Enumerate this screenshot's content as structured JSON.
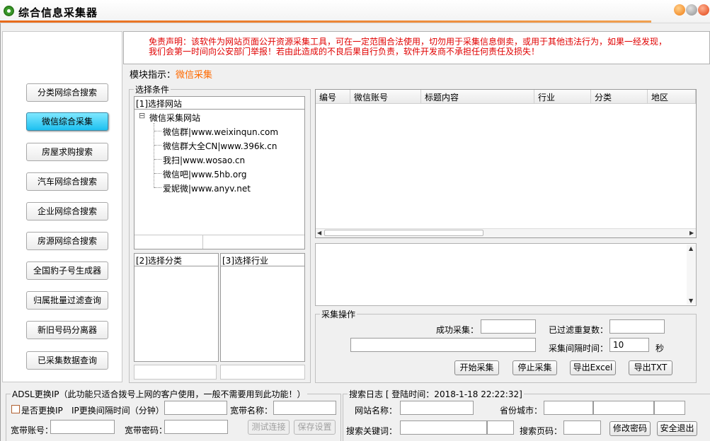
{
  "window": {
    "title": "综合信息采集器"
  },
  "nav": {
    "items": [
      {
        "label": "分类网综合搜索"
      },
      {
        "label": "微信综合采集"
      },
      {
        "label": "房屋求购搜索"
      },
      {
        "label": "汽车网综合搜索"
      },
      {
        "label": "企业网综合搜索"
      },
      {
        "label": "房源网综合搜索"
      },
      {
        "label": "全国豹子号生成器"
      },
      {
        "label": "归属批量过滤查询"
      },
      {
        "label": "新旧号码分离器"
      },
      {
        "label": "已采集数据查询"
      }
    ],
    "active_index": 1
  },
  "disclaimer": {
    "line1": "免责声明：该软件为网站页面公开资源采集工具，可在一定范围合法使用，切勿用于采集信息倒卖，或用于其他违法行为，如果一经发现，",
    "line2": "我们会第一时间向公安部门举报！若由此造成的不良后果自行负责，软件开发商不承担任何责任及损失！"
  },
  "module": {
    "label": "模块指示：",
    "value": "微信采集"
  },
  "select_conditions": {
    "legend": "选择条件",
    "site_header": "[1]选择网站",
    "tree": {
      "root": "微信采集网站",
      "root_toggle": "⊟",
      "children": [
        "微信群|www.weixinqun.com",
        "微信群大全CN|www.396k.cn",
        "我扫|www.wosao.cn",
        "微信吧|www.5hb.org",
        "爱妮微|www.anyv.net"
      ]
    },
    "category_header": "[2]选择分类",
    "industry_header": "[3]选择行业"
  },
  "grid": {
    "columns": [
      "编号",
      "微信账号",
      "标题内容",
      "行业",
      "分类",
      "地区"
    ],
    "rows": []
  },
  "collect": {
    "legend": "采集操作",
    "success_label": "成功采集：",
    "success_value": "",
    "filtered_label": "已过滤重复数：",
    "filtered_value": "",
    "status_value": "",
    "interval_label": "采集间隔时间：",
    "interval_value": "10",
    "interval_unit": "秒",
    "buttons": {
      "start": "开始采集",
      "stop": "停止采集",
      "excel": "导出Excel",
      "txt": "导出TXT"
    }
  },
  "adsl": {
    "legend": "ADSL更换IP（此功能只适合拨号上网的客户使用，一般不需要用到此功能！）",
    "change_ip_label": "是否更换IP",
    "change_ip_checked": false,
    "interval_label": "IP更换间隔时间（分钟）",
    "interval_value": "",
    "bb_name_label": "宽带名称：",
    "bb_name_value": "",
    "bb_account_label": "宽带账号：",
    "bb_account_value": "",
    "bb_password_label": "宽带密码：",
    "bb_password_value": "",
    "test_button": "测试连接",
    "save_button": "保存设置"
  },
  "search_log": {
    "legend": "搜索日志 [ 登陆时间：2018-1-18 22:22:32]",
    "site_label": "网站名称：",
    "site_value": "",
    "province_label": "省份城市：",
    "province_value": "",
    "city_value": "",
    "district_value": "",
    "keyword_label": "搜索关键词：",
    "keyword_value": "",
    "keyword_extra_value": "",
    "page_label": "搜索页码：",
    "page_value": "",
    "change_pwd_button": "修改密码",
    "logout_button": "安全退出"
  }
}
